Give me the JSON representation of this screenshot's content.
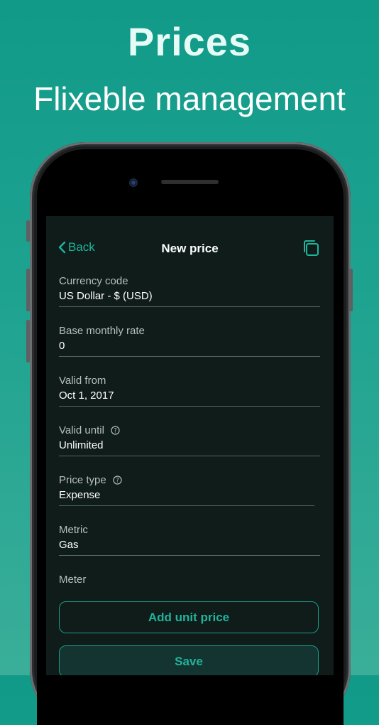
{
  "promo": {
    "title": "Prices",
    "subtitle": "Flixeble management"
  },
  "navbar": {
    "back_label": "Back",
    "title": "New price",
    "copy_icon": "copy-icon"
  },
  "fields": [
    {
      "label": "Currency code",
      "value": "US Dollar - $ (USD)",
      "help": false
    },
    {
      "label": "Base monthly rate",
      "value": "0",
      "help": false
    },
    {
      "label": "Valid from",
      "value": "Oct 1, 2017",
      "help": false
    },
    {
      "label": "Valid until",
      "value": "Unlimited",
      "help": true
    },
    {
      "label": "Price type",
      "value": "Expense",
      "help": true
    },
    {
      "label": "Metric",
      "value": "Gas",
      "help": false
    },
    {
      "label": "Meter",
      "value": "",
      "help": false
    }
  ],
  "actions": {
    "add_unit_price": "Add unit price",
    "save": "Save"
  },
  "colors": {
    "accent": "#1db59c",
    "background_gradient_top": "#119a88",
    "screen_bg": "#0f1c1a"
  }
}
